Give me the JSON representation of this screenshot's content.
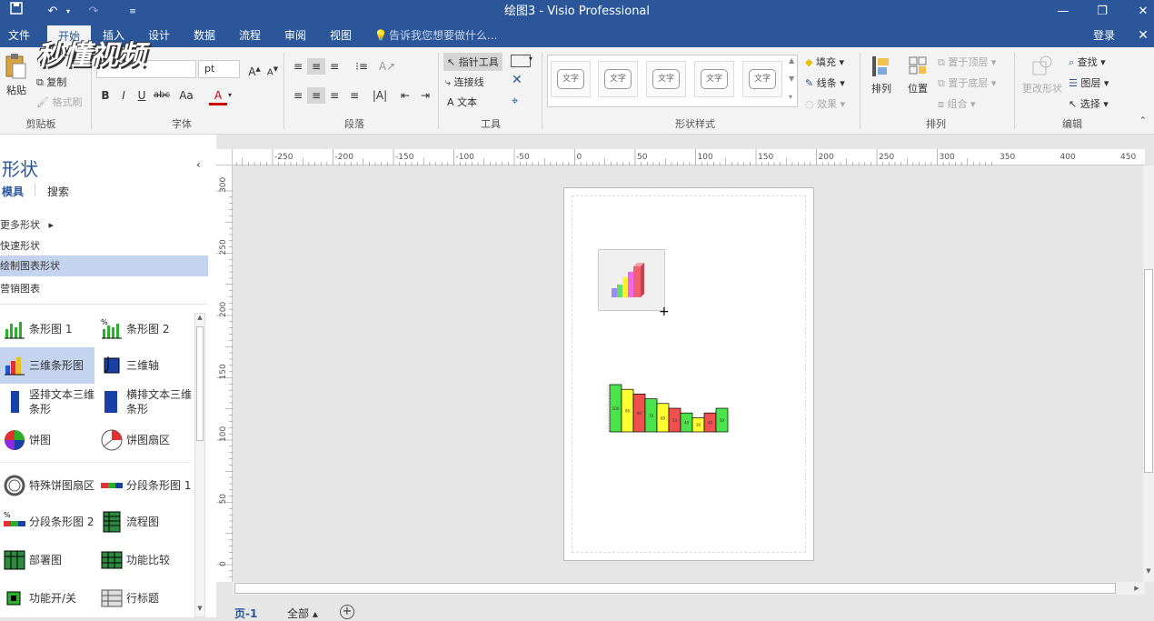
{
  "title": "绘图3 - Visio Professional",
  "watermark": "秒懂视频",
  "menu": {
    "file": "文件",
    "home": "开始",
    "insert": "插入",
    "design": "设计",
    "data": "数据",
    "process": "流程",
    "review": "审阅",
    "view": "视图",
    "tell_me": "告诉我您想要做什么...",
    "login": "登录"
  },
  "ribbon": {
    "paste": "粘贴",
    "copy": "复制",
    "format_painter": "格式刷",
    "clipboard": "剪贴板",
    "font_group": "字体",
    "font_size": "pt",
    "bold": "B",
    "italic": "I",
    "underline": "U",
    "strike": "abc",
    "case": "Aa",
    "paragraph_group": "段落",
    "pointer_tool": "指针工具",
    "connector": "连接线",
    "text_tool": "文本",
    "tools_group": "工具",
    "style_sample": "文字",
    "shape_styles_group": "形状样式",
    "fill": "填充",
    "line": "线条",
    "effects": "效果",
    "bring_front": "置于顶层",
    "send_back": "置于底层",
    "group": "组合",
    "arrange": "排列",
    "position": "位置",
    "arrange_group": "排列",
    "change_shape": "更改形状",
    "find": "查找",
    "layers": "图层",
    "select": "选择",
    "editing_group": "编辑"
  },
  "panel": {
    "title": "形状",
    "tab_stencils": "模具",
    "tab_search": "搜索",
    "more_shapes": "更多形状",
    "quick_shapes": "快速形状",
    "chart_shapes": "绘制图表形状",
    "marketing_charts": "营销图表",
    "items": [
      {
        "label": "条形图 1",
        "icon": "bar-graph-icon"
      },
      {
        "label": "条形图 2",
        "icon": "bar-graph-percent-icon"
      },
      {
        "label": "三维条形图",
        "icon": "3d-bar-graph-icon"
      },
      {
        "label": "三维轴",
        "icon": "3d-axis-icon"
      },
      {
        "label": "竖排文本三维条形",
        "icon": "vertical-text-bar-icon"
      },
      {
        "label": "横排文本三维条形",
        "icon": "horizontal-text-bar-icon"
      },
      {
        "label": "饼图",
        "icon": "pie-chart-icon"
      },
      {
        "label": "饼图扇区",
        "icon": "pie-sector-icon"
      },
      {
        "label": "特殊饼图扇区",
        "icon": "special-pie-sector-icon"
      },
      {
        "label": "分段条形图 1",
        "icon": "segmented-bar-icon"
      },
      {
        "label": "分段条形图 2",
        "icon": "segmented-bar-percent-icon"
      },
      {
        "label": "流程图",
        "icon": "flowchart-grid-icon"
      },
      {
        "label": "部署图",
        "icon": "deployment-grid-icon"
      },
      {
        "label": "功能比较",
        "icon": "feature-compare-icon"
      },
      {
        "label": "功能开/关",
        "icon": "feature-toggle-icon"
      },
      {
        "label": "行标题",
        "icon": "row-header-icon"
      }
    ]
  },
  "ruler_h": [
    "-250",
    "-200",
    "-150",
    "-100",
    "-50",
    "0",
    "50",
    "100",
    "150",
    "200",
    "250",
    "300",
    "350",
    "400",
    "450"
  ],
  "ruler_v": [
    "300",
    "250",
    "200",
    "150",
    "100",
    "50",
    "0"
  ],
  "chart_data": {
    "type": "bar",
    "values": [
      100,
      90,
      80,
      70,
      60,
      50,
      40,
      30,
      40,
      50
    ],
    "colors": [
      "#4be34b",
      "#ffff33",
      "#f05050",
      "#4be34b",
      "#ffff33",
      "#f05050",
      "#4be34b",
      "#ffff33",
      "#f05050",
      "#4be34b"
    ]
  },
  "page_tabs": {
    "page1": "页-1",
    "all": "全部",
    "add": "+"
  }
}
